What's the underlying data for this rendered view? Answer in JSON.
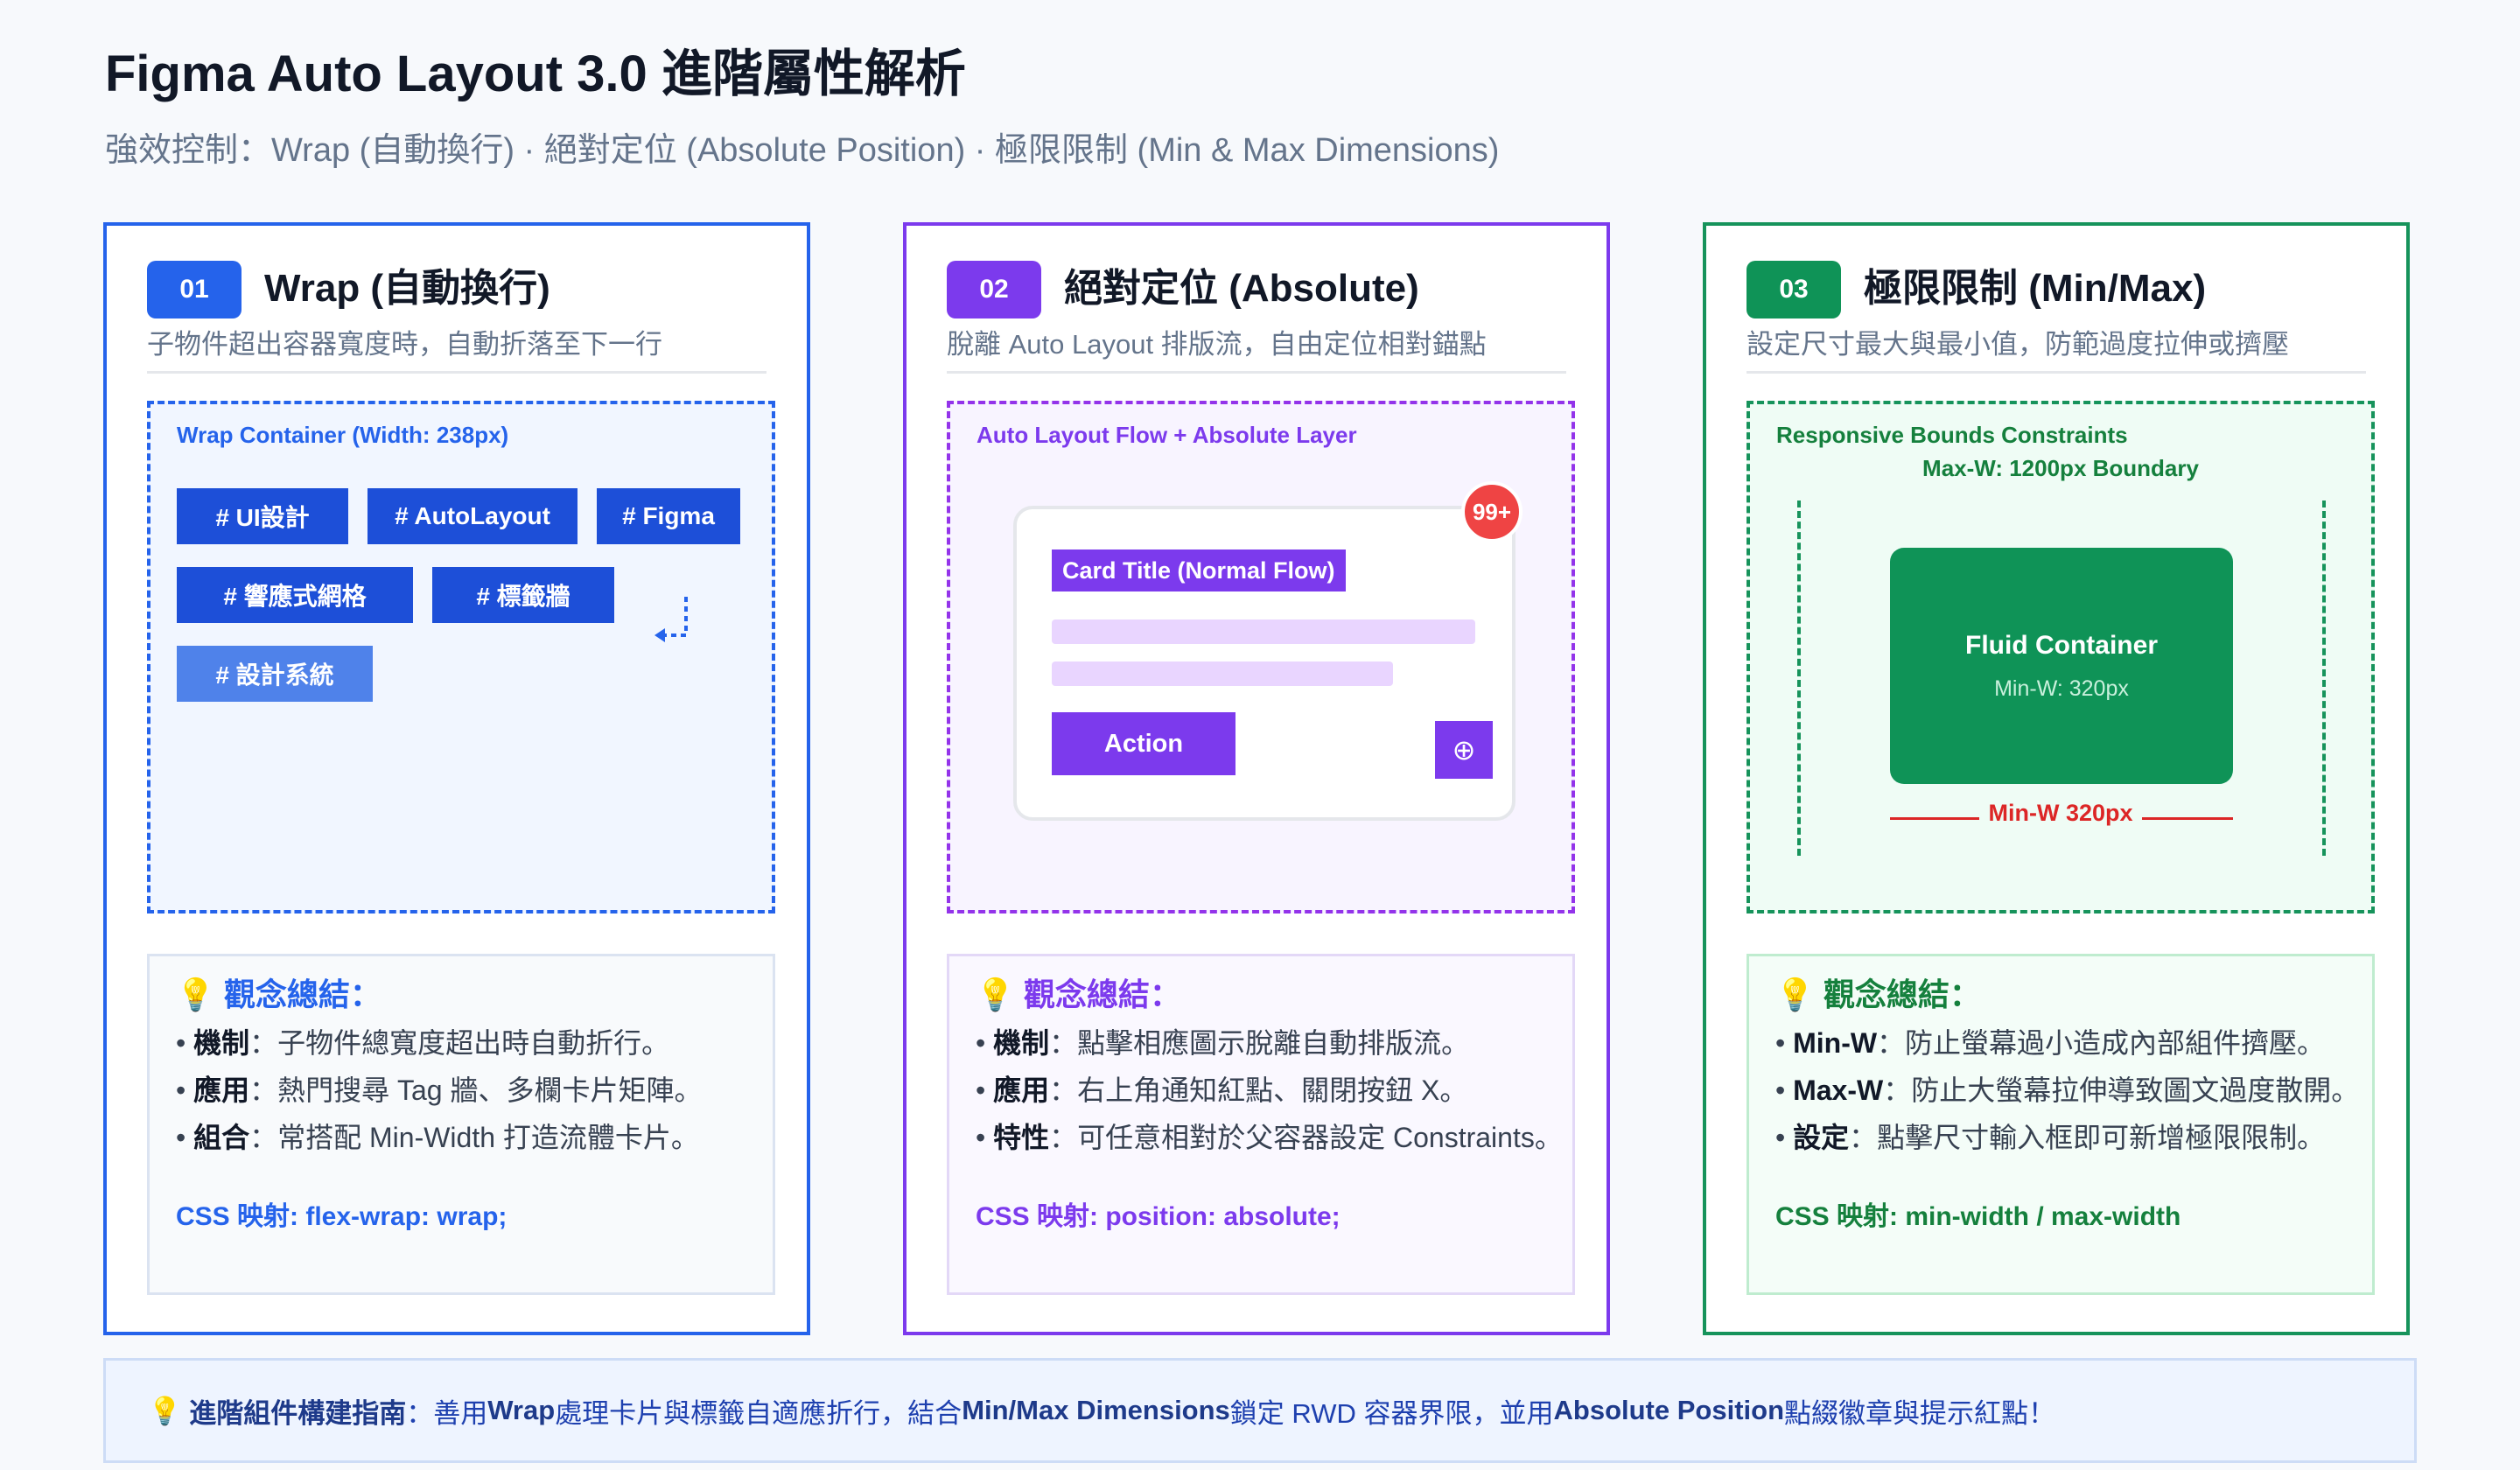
{
  "header": {
    "title": "Figma Auto Layout 3.0 進階屬性解析",
    "subtitle": "強效控制：Wrap (自動換行) · 絕對定位 (Absolute Position) · 極限限制 (Min & Max Dimensions)"
  },
  "cards": [
    {
      "num": "01",
      "title": "Wrap (自動換行)",
      "desc": "子物件超出容器寬度時，自動折落至下一行",
      "demo_label": "Wrap Container (Width: 238px)",
      "tags": [
        "# UI設計",
        "# AutoLayout",
        "# Figma",
        "# 響應式網格",
        "# 標籤牆",
        "# 設計系統"
      ],
      "summary_title": "💡 觀念總結：",
      "items": [
        {
          "term": "機制",
          "text": "：子物件總寬度超出時自動折行。"
        },
        {
          "term": "應用",
          "text": "：熱門搜尋 Tag 牆、多欄卡片矩陣。"
        },
        {
          "term": "組合",
          "text": "：常搭配 Min-Width 打造流體卡片。"
        }
      ],
      "css": "CSS 映射: flex-wrap: wrap;"
    },
    {
      "num": "02",
      "title": "絕對定位 (Absolute)",
      "desc": "脫離 Auto Layout 排版流，自由定位相對錨點",
      "demo_label": "Auto Layout Flow + Absolute Layer",
      "badge_count": "99+",
      "card_title": "Card Title (Normal Flow)",
      "action_label": "Action",
      "plus_symbol": "⊕",
      "summary_title": "💡 觀念總結：",
      "items": [
        {
          "term": "機制",
          "text": "：點擊相應圖示脫離自動排版流。"
        },
        {
          "term": "應用",
          "text": "：右上角通知紅點、關閉按鈕 X。"
        },
        {
          "term": "特性",
          "text": "：可任意相對於父容器設定 Constraints。"
        }
      ],
      "css": "CSS 映射: position: absolute;"
    },
    {
      "num": "03",
      "title": "極限限制 (Min/Max)",
      "desc": "設定尺寸最大與最小值，防範過度拉伸或擠壓",
      "demo_label": "Responsive Bounds Constraints",
      "max_label": "Max-W: 1200px Boundary",
      "fluid_title": "Fluid Container",
      "fluid_sub": "Min-W: 320px",
      "min_label": "Min-W 320px",
      "summary_title": "💡 觀念總結：",
      "items": [
        {
          "term": "Min-W",
          "text": "：防止螢幕過小造成內部組件擠壓。"
        },
        {
          "term": "Max-W",
          "text": "：防止大螢幕拉伸導致圖文過度散開。"
        },
        {
          "term": "設定",
          "text": "：點擊尺寸輸入框即可新增極限限制。"
        }
      ],
      "css": "CSS 映射: min-width / max-width"
    }
  ],
  "footer": {
    "icon": "💡",
    "lead": "進階組件構建指南",
    "t1": "：善用 ",
    "k1": "Wrap",
    "t2": " 處理卡片與標籤自適應折行，結合 ",
    "k2": "Min/Max Dimensions",
    "t3": " 鎖定 RWD 容器界限，並用 ",
    "k3": "Absolute Position",
    "t4": " 點綴徽章與提示紅點！"
  },
  "colors": {
    "blue": "#2563eb",
    "purple": "#7c3aed",
    "green": "#16935b",
    "red": "#ef4444"
  }
}
